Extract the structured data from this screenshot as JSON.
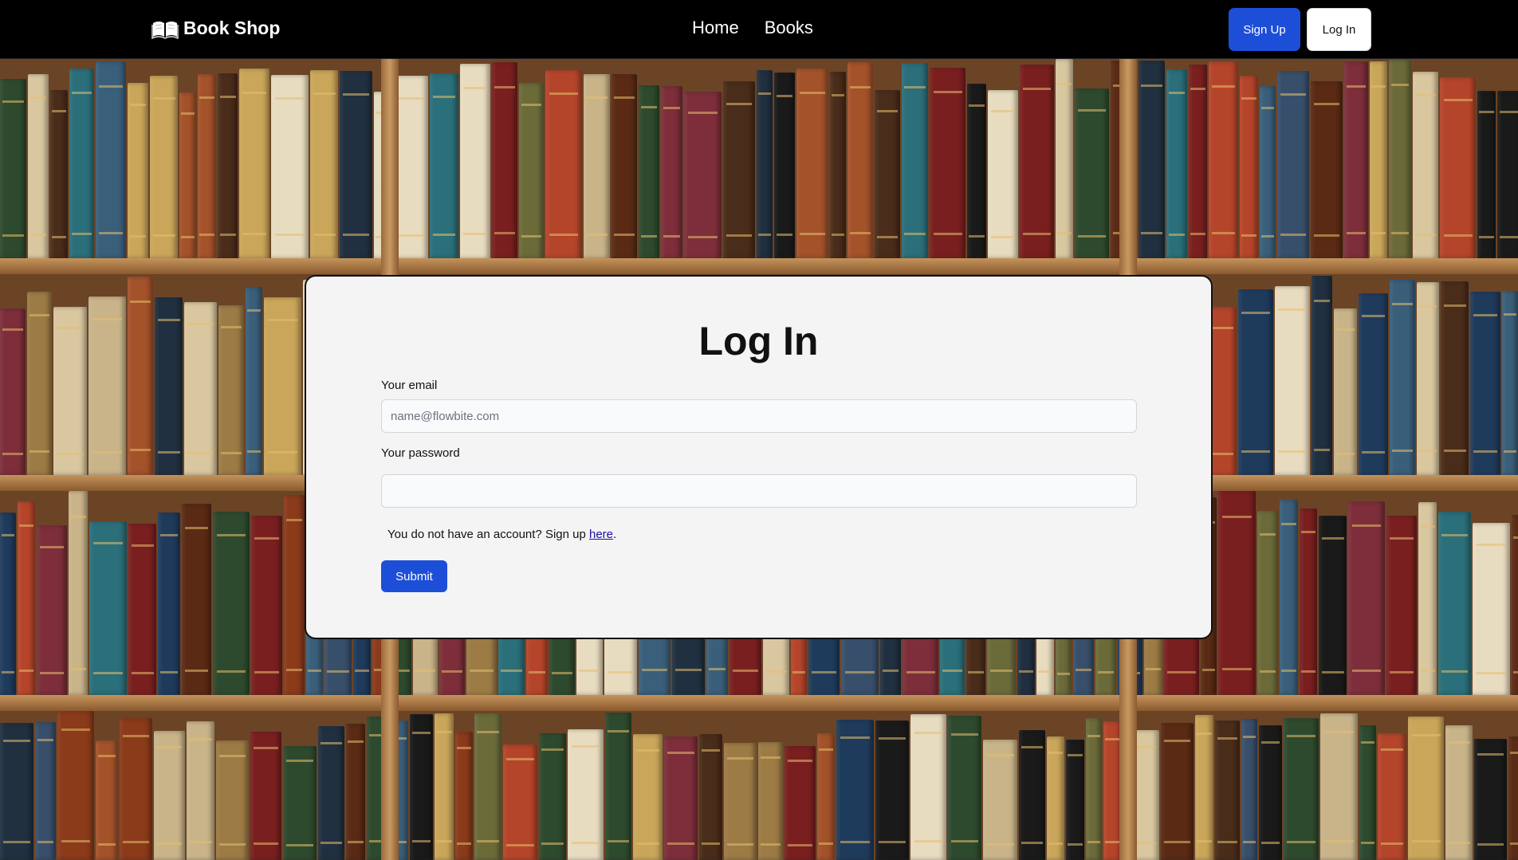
{
  "navbar": {
    "brand": "Book Shop",
    "brand_icon": "open-book-icon",
    "links": [
      "Home",
      "Books"
    ],
    "signup_label": "Sign Up",
    "login_label": "Log In"
  },
  "form": {
    "title": "Log In",
    "email_label": "Your email",
    "email_placeholder": "name@flowbite.com",
    "email_value": "",
    "password_label": "Your password",
    "password_value": "",
    "signup_prefix": "You do not have an account? Sign up ",
    "signup_link": "here",
    "signup_suffix": ".",
    "submit_label": "Submit"
  },
  "colors": {
    "primary": "#1d4ed8",
    "navbar_bg": "#000000",
    "card_bg": "#f4f4f4",
    "link": "#1a0dab"
  },
  "background": "bookshelf-image"
}
